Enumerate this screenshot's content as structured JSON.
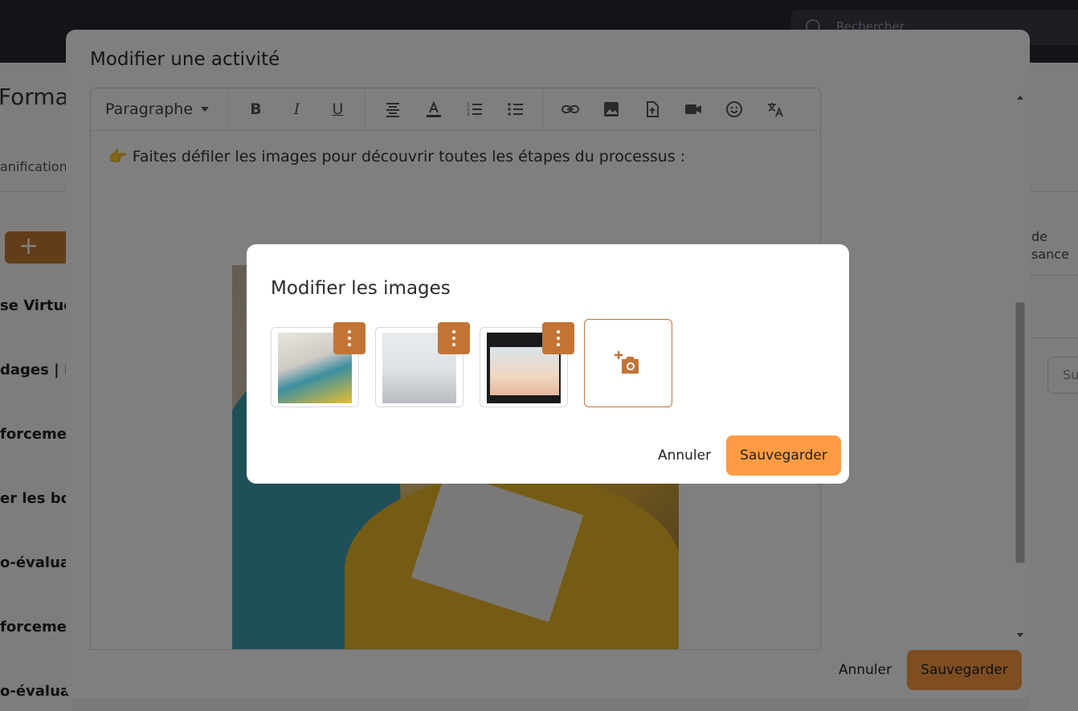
{
  "app": {
    "search_placeholder": "Rechercher",
    "left_title": "Format",
    "left_tab": "anification",
    "add_label": "+",
    "left_rows": [
      "se Virtue",
      "dages | R",
      "forcemen",
      "er les bon",
      "o-évaluat",
      "forcemen",
      "o-évaluat"
    ],
    "right_text_1": "de",
    "right_text_2": "sance",
    "right_field": "Su"
  },
  "editor": {
    "title": "Modifier une activité",
    "toolbar": {
      "paragraph_label": "Paragraphe",
      "bold_label": "B",
      "italic_label": "I",
      "underline_label": "U"
    },
    "content_text": "👉 Faites défiler les images pour découvrir toutes les étapes du processus :",
    "cancel_label": "Annuler",
    "save_label": "Sauvegarder"
  },
  "image_dialog": {
    "title": "Modifier les images",
    "cancel_label": "Annuler",
    "save_label": "Sauvegarder",
    "accent_color": "#c27436",
    "primary_color": "#fd9c44"
  }
}
